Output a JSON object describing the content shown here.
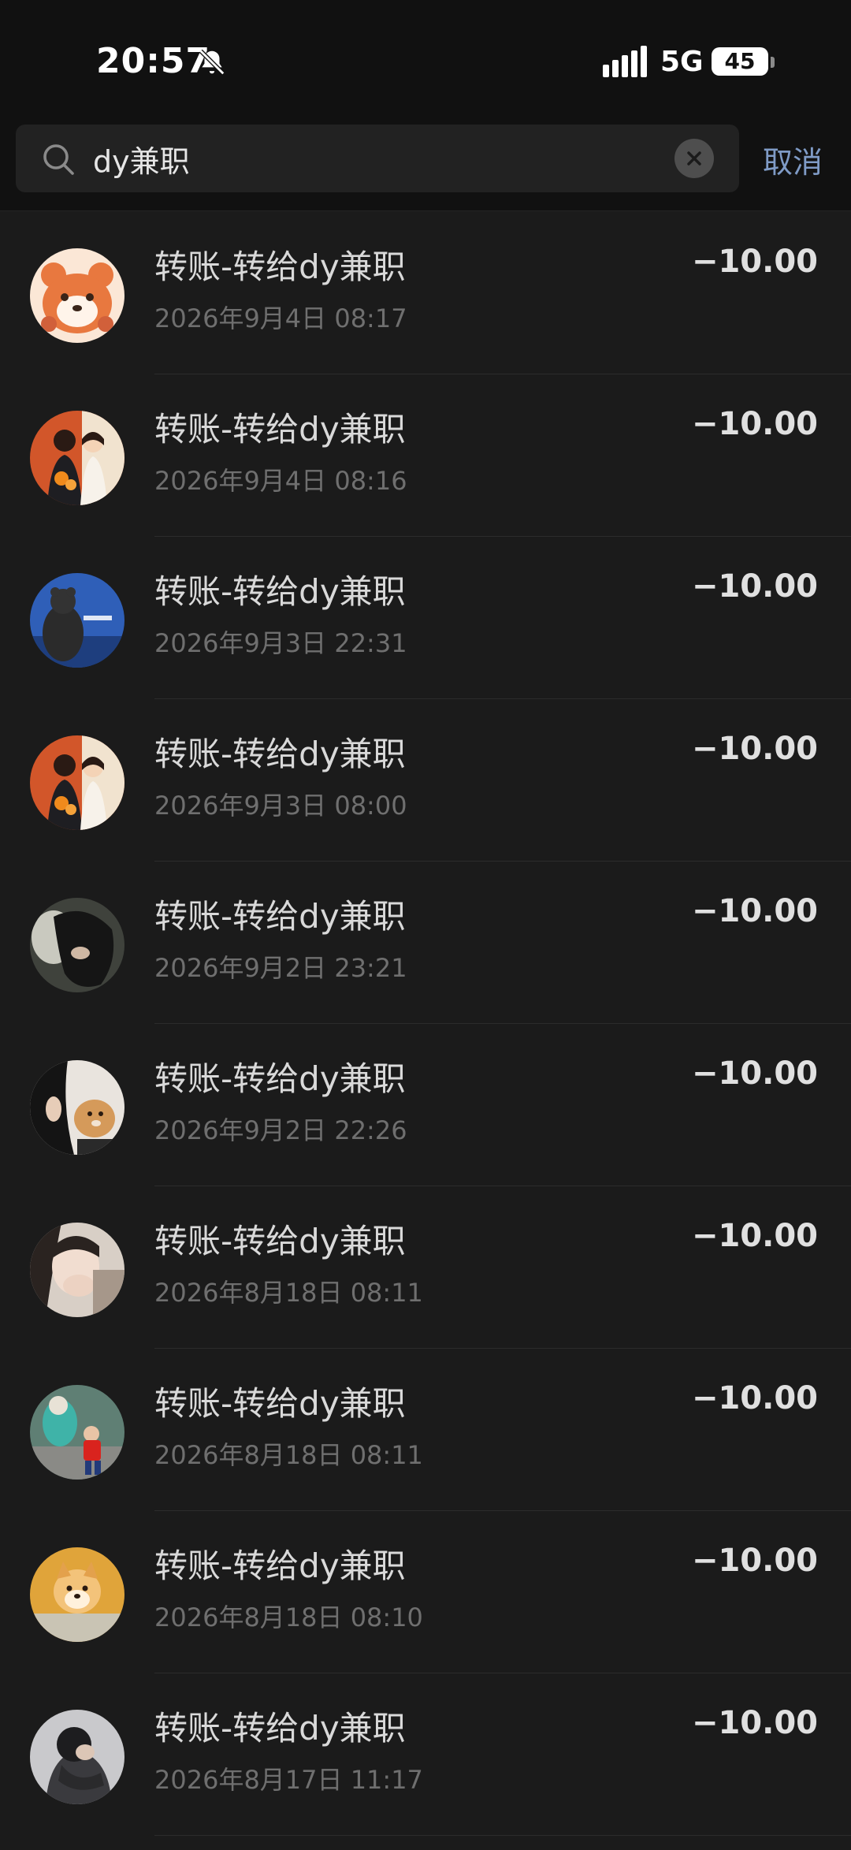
{
  "status_bar": {
    "time": "20:57",
    "network": "5G",
    "battery": "45"
  },
  "search": {
    "query": "dy兼职",
    "cancel_label": "取消"
  },
  "transactions": [
    {
      "title": "转账-转给dy兼职",
      "date": "2026年9月4日 08:17",
      "amount": "−10.00",
      "avatar": "red-panda-cartoon"
    },
    {
      "title": "转账-转给dy兼职",
      "date": "2026年9月4日 08:16",
      "amount": "−10.00",
      "avatar": "couple-illustration"
    },
    {
      "title": "转账-转给dy兼职",
      "date": "2026年9月3日 22:31",
      "amount": "−10.00",
      "avatar": "bear-blue-background"
    },
    {
      "title": "转账-转给dy兼职",
      "date": "2026年9月3日 08:00",
      "amount": "−10.00",
      "avatar": "couple-illustration"
    },
    {
      "title": "转账-转给dy兼职",
      "date": "2026年9月2日 23:21",
      "amount": "−10.00",
      "avatar": "person-dark-hair"
    },
    {
      "title": "转账-转给dy兼职",
      "date": "2026年9月2日 22:26",
      "amount": "−10.00",
      "avatar": "person-with-dog"
    },
    {
      "title": "转账-转给dy兼职",
      "date": "2026年8月18日 08:11",
      "amount": "−10.00",
      "avatar": "person-covering-face"
    },
    {
      "title": "转账-转给dy兼职",
      "date": "2026年8月18日 08:11",
      "amount": "−10.00",
      "avatar": "child-with-mascot"
    },
    {
      "title": "转账-转给dy兼职",
      "date": "2026年8月18日 08:10",
      "amount": "−10.00",
      "avatar": "shiba-dog"
    },
    {
      "title": "转账-转给dy兼职",
      "date": "2026年8月17日 11:17",
      "amount": "−10.00",
      "avatar": "person-hoodie"
    }
  ]
}
